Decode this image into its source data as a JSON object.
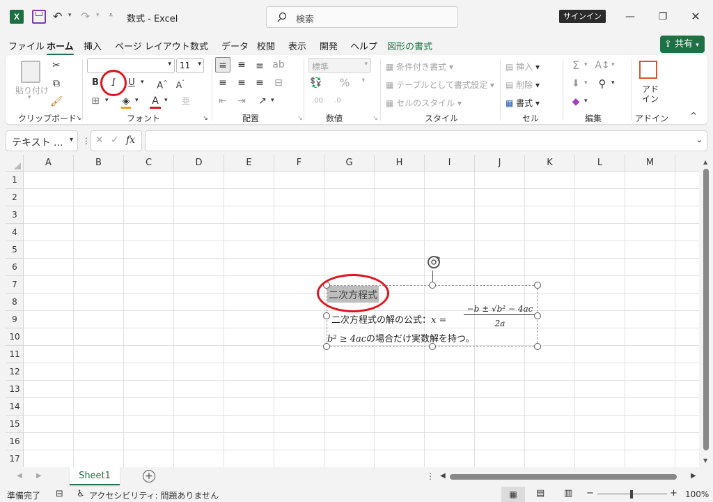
{
  "app": {
    "title": "数式  -  Excel",
    "search_placeholder": "検索",
    "signin": "サインイン",
    "share": "共有"
  },
  "tabs": [
    "ファイル",
    "ホーム",
    "挿入",
    "ページ レイアウト",
    "数式",
    "データ",
    "校閲",
    "表示",
    "開発",
    "ヘルプ",
    "図形の書式"
  ],
  "ribbon": {
    "clipboard": {
      "paste": "貼り付け",
      "label": "クリップボード"
    },
    "font": {
      "size": "11",
      "bold": "B",
      "italic": "I",
      "underline": "U",
      "grow": "A^",
      "shrink": "Aˇ",
      "label": "フォント"
    },
    "alignment": {
      "label": "配置"
    },
    "number": {
      "format": "標準",
      "label": "数値"
    },
    "styles": {
      "conditional": "条件付き書式",
      "table": "テーブルとして書式設定",
      "cell_styles": "セルのスタイル",
      "label": "スタイル"
    },
    "cells": {
      "insert": "挿入",
      "delete": "削除",
      "format": "書式",
      "label": "セル"
    },
    "editing": {
      "label": "編集"
    },
    "addins": {
      "name": "アド イン",
      "label": "アドイン"
    }
  },
  "formula_bar": {
    "name_box": "テキスト ...",
    "fx": "fx",
    "formula": ""
  },
  "columns": [
    "A",
    "B",
    "C",
    "D",
    "E",
    "F",
    "G",
    "H",
    "I",
    "J",
    "K",
    "L",
    "M"
  ],
  "rows": [
    "1",
    "2",
    "3",
    "4",
    "5",
    "6",
    "7",
    "8",
    "9",
    "10",
    "11",
    "12",
    "13",
    "14",
    "15",
    "16",
    "17"
  ],
  "textbox": {
    "title": "二次方程式",
    "line1_prefix": "二次方程式の解の公式：",
    "line1_math_lhs": "x =",
    "numerator": "−b ± √b² − 4ac",
    "denominator": "2a",
    "line2_math": "b² ≥ 4ac",
    "line2_text": "の場合だけ実数解を持つ。"
  },
  "sheet": {
    "name": "Sheet1"
  },
  "status": {
    "ready": "準備完了",
    "accessibility": "アクセシビリティ: 問題ありません",
    "zoom": "100%"
  },
  "colors": {
    "accent": "#1e7145",
    "highlight": "#e0141e"
  }
}
